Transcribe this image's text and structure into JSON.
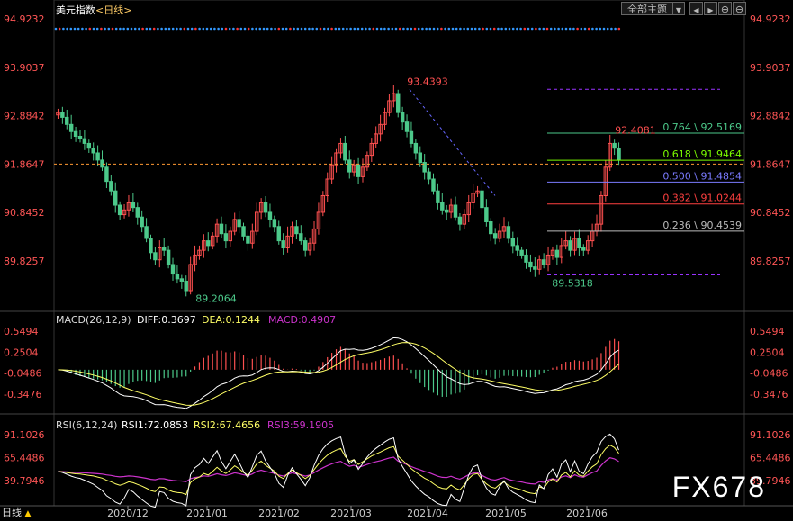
{
  "header": {
    "title": "美元指数",
    "period": "<日线>",
    "theme_button": "全部主题",
    "dropdown_glyph": "▼",
    "nav": [
      "◀",
      "▶",
      "⊕",
      "⊖"
    ]
  },
  "watermark": "FX678",
  "bottom_tab": {
    "label": "日线",
    "arrow": "▲"
  },
  "colors": {
    "up": "#ff5050",
    "down": "#4cc98a",
    "ma": "#ffffff",
    "dea": "#ffff66",
    "macd_line": "#cc33cc",
    "axis_text": "#ff5555"
  },
  "chart_data": [
    {
      "type": "candlestick",
      "name": "main",
      "y_ticks": [
        "94.9232",
        "93.9037",
        "92.8842",
        "91.8647",
        "90.8452",
        "89.8257"
      ],
      "y_tick_values": [
        94.9232,
        93.9037,
        92.8842,
        91.8647,
        90.8452,
        89.8257
      ],
      "x_ticks": [
        "2020/12",
        "2021/01",
        "2021/02",
        "2021/03",
        "2021/04",
        "2021/05",
        "2021/06"
      ],
      "current_price": 91.8647,
      "annotations": [
        {
          "label": "93.4393",
          "value": 93.4393
        },
        {
          "label": "89.2064",
          "value": 89.2064
        },
        {
          "label": "89.5318",
          "value": 89.5318
        },
        {
          "label": "92.4081",
          "value": 92.4081
        }
      ],
      "fibonacci": [
        {
          "label": "0.764 \\ 92.5169",
          "value": 92.5169,
          "color": "#4cc98a"
        },
        {
          "label": "0.618 \\ 91.9464",
          "value": 91.9464,
          "color": "#7cfc00"
        },
        {
          "label": "0.500 \\ 91.4854",
          "value": 91.4854,
          "color": "#7b7bff"
        },
        {
          "label": "0.382 \\ 91.0244",
          "value": 91.0244,
          "color": "#ff4040"
        },
        {
          "label": "0.236 \\ 90.4539",
          "value": 90.4539,
          "color": "#bbbbbb"
        }
      ],
      "fib_bounds": [
        93.4393,
        89.5318
      ],
      "closes": [
        92.95,
        92.85,
        92.7,
        92.55,
        92.45,
        92.4,
        92.3,
        92.2,
        92.1,
        91.95,
        91.8,
        91.5,
        91.3,
        91.0,
        90.8,
        90.9,
        91.05,
        90.95,
        90.75,
        90.55,
        90.3,
        90.0,
        89.85,
        90.1,
        90.05,
        89.75,
        89.55,
        89.45,
        89.4,
        89.2,
        89.75,
        89.95,
        90.05,
        90.25,
        90.15,
        90.35,
        90.6,
        90.4,
        90.25,
        90.45,
        90.7,
        90.55,
        90.35,
        90.2,
        90.45,
        90.85,
        91.05,
        90.85,
        90.7,
        90.55,
        90.25,
        90.1,
        90.35,
        90.55,
        90.4,
        90.25,
        90.05,
        90.2,
        90.5,
        90.85,
        91.2,
        91.55,
        91.85,
        92.1,
        92.3,
        91.95,
        91.7,
        91.85,
        91.6,
        91.8,
        92.05,
        92.3,
        92.5,
        92.7,
        92.95,
        93.2,
        93.35,
        92.95,
        92.75,
        92.55,
        92.3,
        92.1,
        91.9,
        91.7,
        91.55,
        91.3,
        91.05,
        90.9,
        90.85,
        91.0,
        90.75,
        90.6,
        90.8,
        91.05,
        91.25,
        91.3,
        90.95,
        90.65,
        90.4,
        90.3,
        90.45,
        90.55,
        90.3,
        90.15,
        90.05,
        89.95,
        89.8,
        89.7,
        89.65,
        89.85,
        89.75,
        89.95,
        90.05,
        89.9,
        90.15,
        90.25,
        90.05,
        90.3,
        90.1,
        90.05,
        90.25,
        90.45,
        90.6,
        91.2,
        91.8,
        92.3,
        92.2,
        91.95
      ],
      "ma_points": [],
      "trend_line_label": ""
    },
    {
      "type": "macd",
      "title": "MACD(26,12,9)",
      "values": [
        {
          "label": "DIFF:0.3697",
          "color": "#ffffff"
        },
        {
          "label": "DEA:0.1244",
          "color": "#ffff66"
        },
        {
          "label": "MACD:0.4907",
          "color": "#cc33cc"
        }
      ],
      "y_ticks": [
        "0.5494",
        "0.2504",
        "-0.0486",
        "-0.3476"
      ],
      "y_tick_values": [
        0.5494,
        0.2504,
        -0.0486,
        -0.3476
      ]
    },
    {
      "type": "rsi",
      "title": "RSI(6,12,24)",
      "values": [
        {
          "label": "RSI1:72.0853",
          "color": "#ffffff"
        },
        {
          "label": "RSI2:67.4656",
          "color": "#ffff66"
        },
        {
          "label": "RSI3:59.1905",
          "color": "#cc33cc"
        }
      ],
      "y_ticks": [
        "91.1026",
        "65.4486",
        "39.7946"
      ],
      "y_tick_values": [
        91.1026,
        65.4486,
        39.7946
      ]
    }
  ]
}
